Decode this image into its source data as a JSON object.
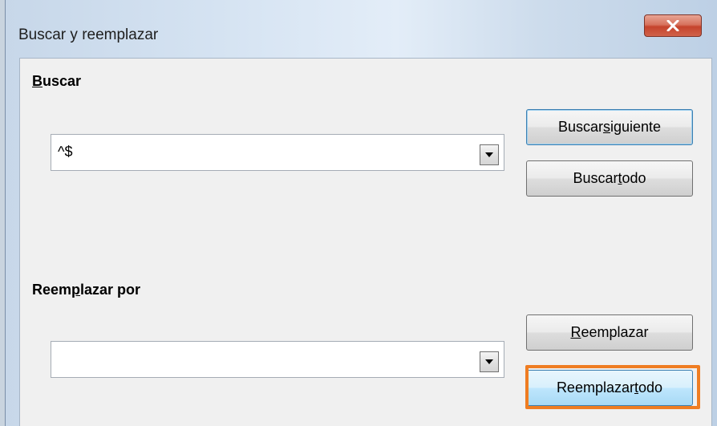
{
  "window": {
    "title": "Buscar y reemplazar",
    "close_icon": "close-x-icon"
  },
  "search": {
    "label_accel": "B",
    "label_rest": "uscar",
    "value": "^$",
    "dropdown_icon": "chevron-down-icon"
  },
  "replace": {
    "label_pre": "Reem",
    "label_accel": "p",
    "label_post": "lazar por",
    "value": "",
    "dropdown_icon": "chevron-down-icon"
  },
  "buttons": {
    "find_next": {
      "pre": "Buscar ",
      "accel": "s",
      "post": "iguiente"
    },
    "find_all": {
      "pre": "Buscar ",
      "accel": "t",
      "post": "odo"
    },
    "replace": {
      "pre": "",
      "accel": "R",
      "post": "eemplazar"
    },
    "replace_all": {
      "pre": "Reemplazar ",
      "accel": "t",
      "post": "odo"
    }
  },
  "colors": {
    "highlight": "#ef7d22",
    "close_button": "#c5432c",
    "accent_border": "#3c7fb1"
  }
}
